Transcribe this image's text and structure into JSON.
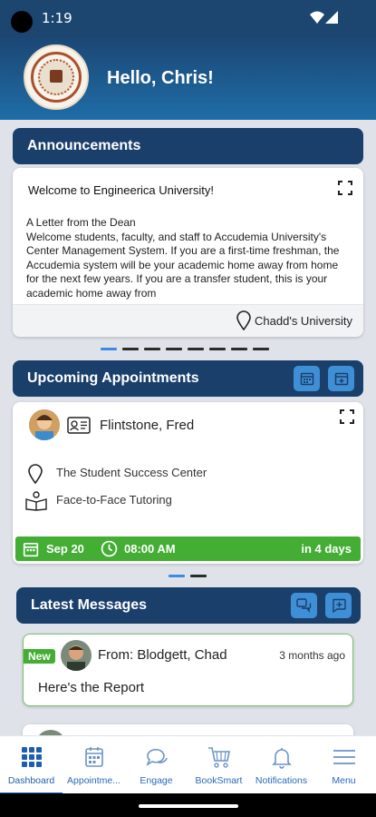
{
  "status_bar": {
    "time": "1:19"
  },
  "header": {
    "greeting": "Hello, Chris!"
  },
  "announcements": {
    "section_label": "Announcements",
    "card": {
      "title": "Welcome to Engineerica University!",
      "body_lines": [
        "A Letter from the Dean",
        "Welcome students, faculty, and staff to Accudemia University's Center Management System. If you are a first-time freshman, the Accudemia system will be your academic home away from home for the next few years. If you are a transfer student, this is your academic home away from"
      ],
      "location": "Chadd's University"
    },
    "pager": {
      "count": 8,
      "active_index": 0
    }
  },
  "appointments": {
    "section_label": "Upcoming Appointments",
    "card": {
      "name": "Flintstone, Fred",
      "location": "The Student Success Center",
      "service": "Face-to-Face Tutoring",
      "date": "Sep 20",
      "time": "08:00 AM",
      "relative": "in 4 days"
    },
    "pager": {
      "count": 2,
      "active_index": 0
    }
  },
  "messages": {
    "section_label": "Latest Messages",
    "items": [
      {
        "badge": "New",
        "from": "From: Blodgett, Chad",
        "ago": "3 months ago",
        "subject": "Here's the Report"
      }
    ]
  },
  "bottom_nav": {
    "items": [
      {
        "label": "Dashboard",
        "icon": "grid-icon"
      },
      {
        "label": "Appointme...",
        "icon": "calendar-icon"
      },
      {
        "label": "Engage",
        "icon": "chat-bubbles-icon"
      },
      {
        "label": "BookSmart",
        "icon": "cart-icon"
      },
      {
        "label": "Notifications",
        "icon": "bell-icon"
      },
      {
        "label": "Menu",
        "icon": "hamburger-icon"
      }
    ]
  },
  "colors": {
    "header_dark": "#1b4674",
    "section_bar": "#1a3f6b",
    "accent_blue": "#3f8fd6",
    "success_green": "#43ad34"
  }
}
